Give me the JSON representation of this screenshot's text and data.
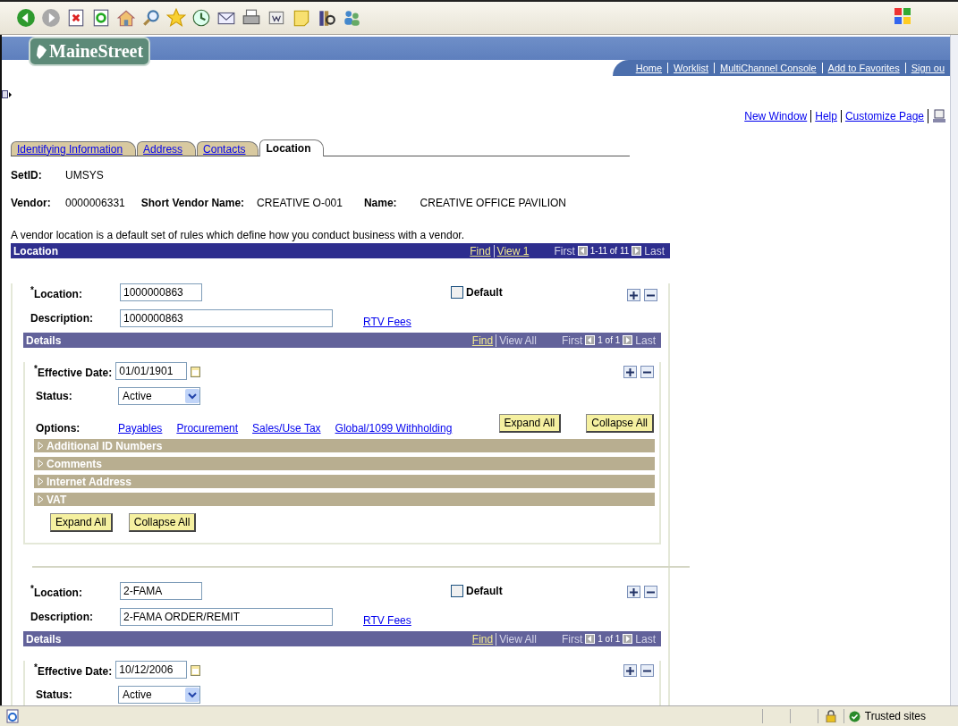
{
  "header": {
    "logo": "MaineStreet",
    "nav_links": [
      "Home",
      "Worklist",
      "MultiChannel Console",
      "Add to Favorites",
      "Sign ou"
    ]
  },
  "page_links": [
    "New Window",
    "Help",
    "Customize Page"
  ],
  "tabs": [
    {
      "label": "Identifying Information",
      "selected": false
    },
    {
      "label": "Address",
      "selected": false
    },
    {
      "label": "Contacts",
      "selected": false
    },
    {
      "label": "Location",
      "selected": true
    }
  ],
  "vendor": {
    "setid_label": "SetID:",
    "setid": "UMSYS",
    "vendor_label": "Vendor:",
    "vendor": "0000006331",
    "short_name_label": "Short Vendor Name:",
    "short_name": "CREATIVE O-001",
    "name_label": "Name:",
    "name": "CREATIVE OFFICE PAVILION"
  },
  "intro": "A vendor location is a default set of rules which define how you conduct business with a vendor.",
  "location_grid": {
    "title": "Location",
    "find": "Find",
    "view": "View 1",
    "first": "First",
    "range": "1-11 of 11",
    "last": "Last"
  },
  "locations": [
    {
      "location_label": "$^{*}$Location:",
      "location": "1000000863",
      "default_label": "Default",
      "default_checked": false,
      "description_label": "Description:",
      "description": "1000000863",
      "rtv_link": "RTV Fees",
      "details": {
        "title": "Details",
        "find": "Find",
        "view_all": "View All",
        "first": "First",
        "range": "1 of 1",
        "last": "Last",
        "date_label": "$^{*}$Effective Date:",
        "date": "01/01/1901",
        "status_label": "Status:",
        "status": "Active",
        "options_label": "Options:",
        "options": [
          "Payables",
          "Procurement",
          "Sales/Use Tax",
          "Global/1099 Withholding"
        ],
        "top_buttons": [
          "Expand All",
          "Collapse All"
        ],
        "sections": [
          {
            "label": "Additional ID Numbers",
            "expanded": false
          },
          {
            "label": "Comments",
            "expanded": false
          },
          {
            "label": "Internet Address",
            "expanded": false
          },
          {
            "label": "VAT",
            "expanded": false
          }
        ],
        "bottom_buttons": [
          "Expand All",
          "Collapse All"
        ]
      }
    },
    {
      "location_label": "$^{*}$Location:",
      "location": "2-FAMA",
      "default_label": "Default",
      "default_checked": false,
      "description_label": "Description:",
      "description": "2-FAMA ORDER/REMIT",
      "rtv_link": "RTV Fees",
      "details": {
        "title": "Details",
        "find": "Find",
        "view_all": "View All",
        "first": "First",
        "range": "1 of 1",
        "last": "Last",
        "date_label": "$^{*}$Effective Date:",
        "date": "10/12/2006",
        "status_label": "Status:",
        "status": "Active"
      }
    }
  ],
  "status_bar": {
    "zone": "Trusted sites"
  }
}
